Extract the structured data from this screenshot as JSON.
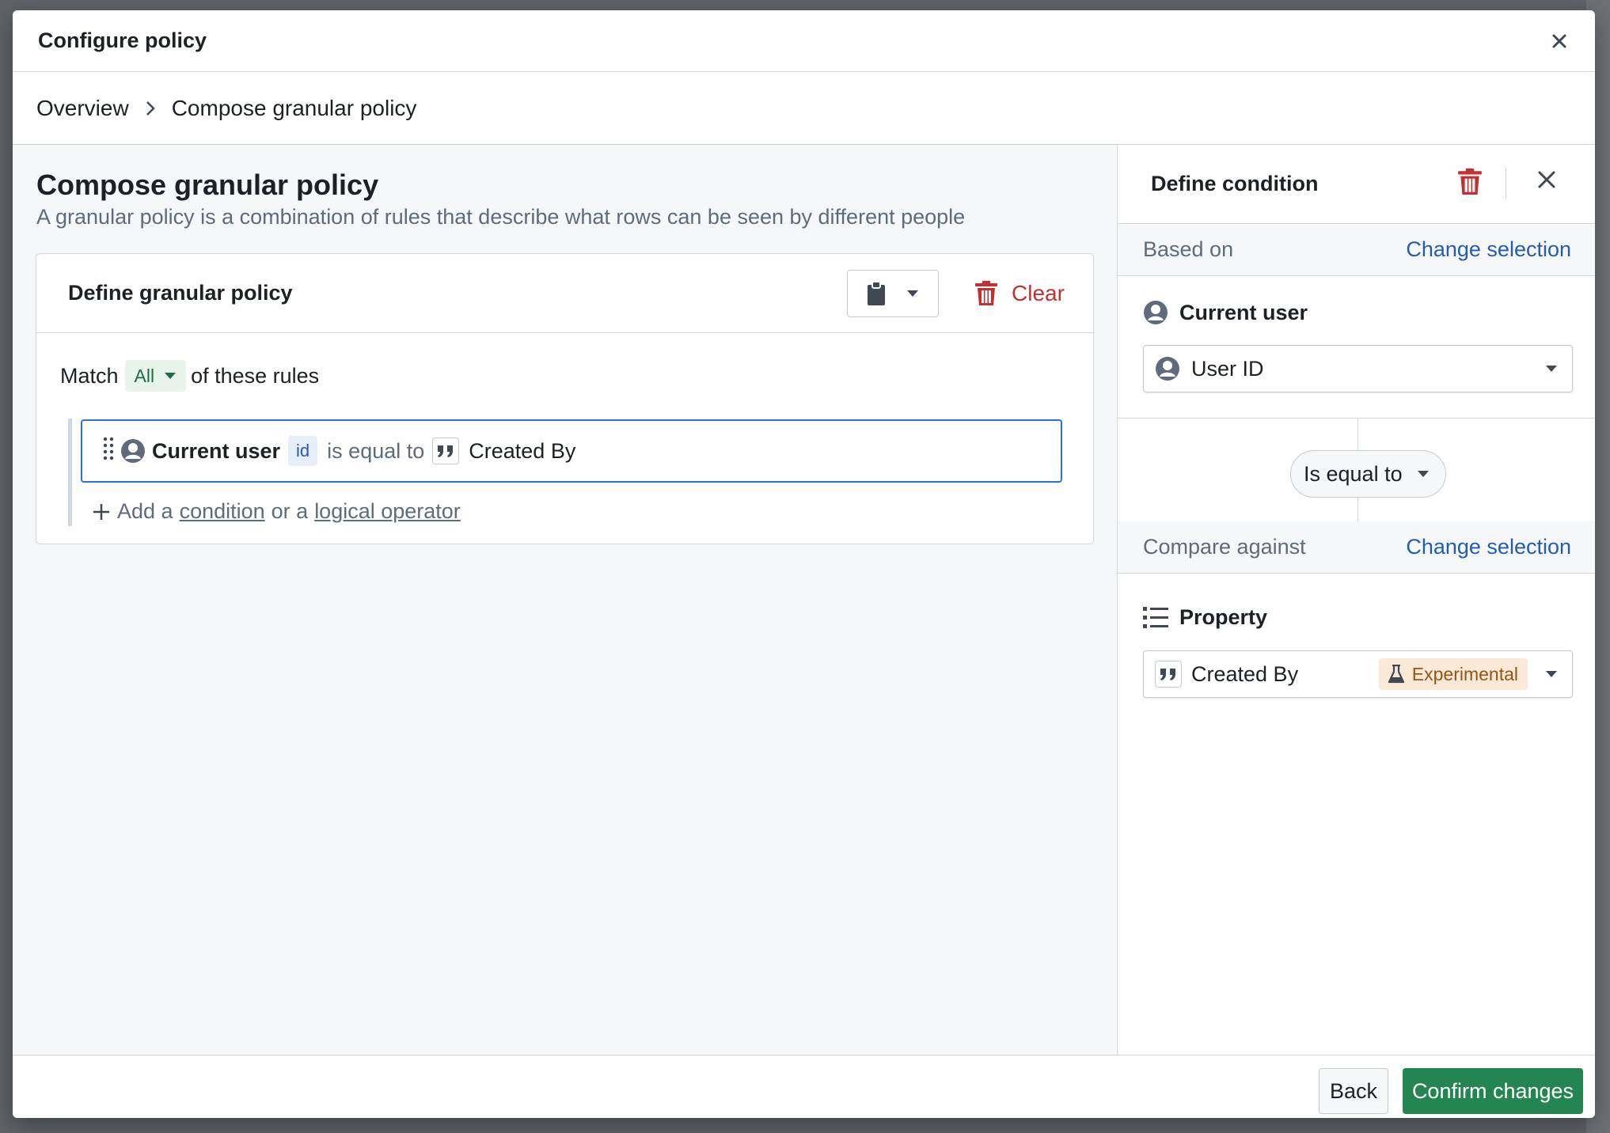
{
  "modal": {
    "title": "Configure policy"
  },
  "breadcrumb": {
    "items": [
      "Overview",
      "Compose granular policy"
    ]
  },
  "main": {
    "title": "Compose granular policy",
    "subtitle": "A granular policy is a combination of rules that describe what rows can be seen by different people",
    "card": {
      "title": "Define granular policy",
      "clear_label": "Clear",
      "match_prefix": "Match",
      "match_value": "All",
      "match_suffix": "of these rules",
      "rule": {
        "subject": "Current user",
        "subject_tag": "id",
        "operator": "is equal to",
        "value": "Created By"
      },
      "add": {
        "prefix": "Add a",
        "condition_link": "condition",
        "middle": "or a",
        "operator_link": "logical operator"
      }
    }
  },
  "condition_panel": {
    "title": "Define condition",
    "based_on_label": "Based on",
    "change_selection": "Change selection",
    "subject_label": "Current user",
    "subject_select": "User ID",
    "operator_select": "Is equal to",
    "compare_label": "Compare against",
    "property_label": "Property",
    "property_select": "Created By",
    "property_tag": "Experimental"
  },
  "footer": {
    "back_label": "Back",
    "confirm_label": "Confirm changes"
  },
  "colors": {
    "primary_link": "#215db0",
    "danger": "#c23030",
    "confirm": "#238551",
    "focus_border": "#2d72d2"
  },
  "icons": [
    "close-icon",
    "chevron-right-icon",
    "clipboard-icon",
    "caret-down-icon",
    "trash-icon",
    "drag-handle-icon",
    "user-icon",
    "quote-icon",
    "plus-icon",
    "property-list-icon",
    "flask-icon"
  ]
}
